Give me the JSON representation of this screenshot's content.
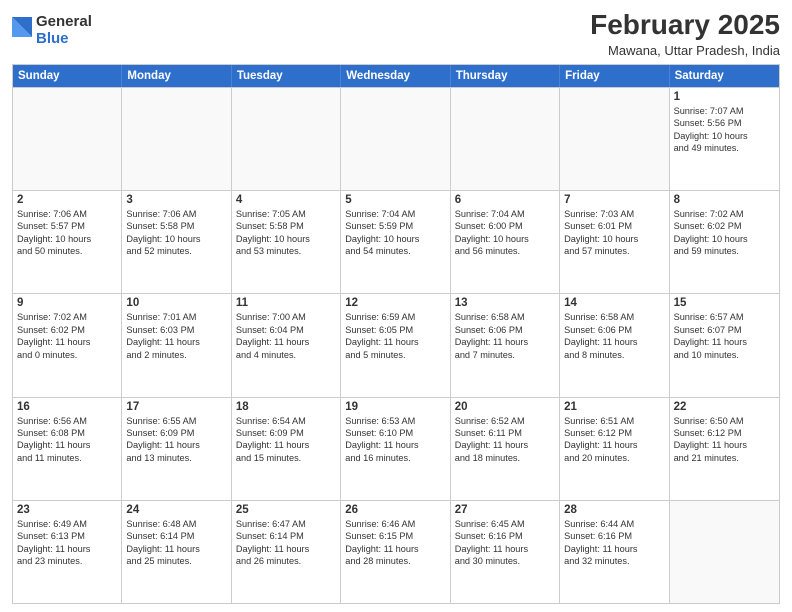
{
  "header": {
    "logo_general": "General",
    "logo_blue": "Blue",
    "month_title": "February 2025",
    "location": "Mawana, Uttar Pradesh, India"
  },
  "weekdays": [
    "Sunday",
    "Monday",
    "Tuesday",
    "Wednesday",
    "Thursday",
    "Friday",
    "Saturday"
  ],
  "rows": [
    [
      {
        "day": "",
        "info": ""
      },
      {
        "day": "",
        "info": ""
      },
      {
        "day": "",
        "info": ""
      },
      {
        "day": "",
        "info": ""
      },
      {
        "day": "",
        "info": ""
      },
      {
        "day": "",
        "info": ""
      },
      {
        "day": "1",
        "info": "Sunrise: 7:07 AM\nSunset: 5:56 PM\nDaylight: 10 hours\nand 49 minutes."
      }
    ],
    [
      {
        "day": "2",
        "info": "Sunrise: 7:06 AM\nSunset: 5:57 PM\nDaylight: 10 hours\nand 50 minutes."
      },
      {
        "day": "3",
        "info": "Sunrise: 7:06 AM\nSunset: 5:58 PM\nDaylight: 10 hours\nand 52 minutes."
      },
      {
        "day": "4",
        "info": "Sunrise: 7:05 AM\nSunset: 5:58 PM\nDaylight: 10 hours\nand 53 minutes."
      },
      {
        "day": "5",
        "info": "Sunrise: 7:04 AM\nSunset: 5:59 PM\nDaylight: 10 hours\nand 54 minutes."
      },
      {
        "day": "6",
        "info": "Sunrise: 7:04 AM\nSunset: 6:00 PM\nDaylight: 10 hours\nand 56 minutes."
      },
      {
        "day": "7",
        "info": "Sunrise: 7:03 AM\nSunset: 6:01 PM\nDaylight: 10 hours\nand 57 minutes."
      },
      {
        "day": "8",
        "info": "Sunrise: 7:02 AM\nSunset: 6:02 PM\nDaylight: 10 hours\nand 59 minutes."
      }
    ],
    [
      {
        "day": "9",
        "info": "Sunrise: 7:02 AM\nSunset: 6:02 PM\nDaylight: 11 hours\nand 0 minutes."
      },
      {
        "day": "10",
        "info": "Sunrise: 7:01 AM\nSunset: 6:03 PM\nDaylight: 11 hours\nand 2 minutes."
      },
      {
        "day": "11",
        "info": "Sunrise: 7:00 AM\nSunset: 6:04 PM\nDaylight: 11 hours\nand 4 minutes."
      },
      {
        "day": "12",
        "info": "Sunrise: 6:59 AM\nSunset: 6:05 PM\nDaylight: 11 hours\nand 5 minutes."
      },
      {
        "day": "13",
        "info": "Sunrise: 6:58 AM\nSunset: 6:06 PM\nDaylight: 11 hours\nand 7 minutes."
      },
      {
        "day": "14",
        "info": "Sunrise: 6:58 AM\nSunset: 6:06 PM\nDaylight: 11 hours\nand 8 minutes."
      },
      {
        "day": "15",
        "info": "Sunrise: 6:57 AM\nSunset: 6:07 PM\nDaylight: 11 hours\nand 10 minutes."
      }
    ],
    [
      {
        "day": "16",
        "info": "Sunrise: 6:56 AM\nSunset: 6:08 PM\nDaylight: 11 hours\nand 11 minutes."
      },
      {
        "day": "17",
        "info": "Sunrise: 6:55 AM\nSunset: 6:09 PM\nDaylight: 11 hours\nand 13 minutes."
      },
      {
        "day": "18",
        "info": "Sunrise: 6:54 AM\nSunset: 6:09 PM\nDaylight: 11 hours\nand 15 minutes."
      },
      {
        "day": "19",
        "info": "Sunrise: 6:53 AM\nSunset: 6:10 PM\nDaylight: 11 hours\nand 16 minutes."
      },
      {
        "day": "20",
        "info": "Sunrise: 6:52 AM\nSunset: 6:11 PM\nDaylight: 11 hours\nand 18 minutes."
      },
      {
        "day": "21",
        "info": "Sunrise: 6:51 AM\nSunset: 6:12 PM\nDaylight: 11 hours\nand 20 minutes."
      },
      {
        "day": "22",
        "info": "Sunrise: 6:50 AM\nSunset: 6:12 PM\nDaylight: 11 hours\nand 21 minutes."
      }
    ],
    [
      {
        "day": "23",
        "info": "Sunrise: 6:49 AM\nSunset: 6:13 PM\nDaylight: 11 hours\nand 23 minutes."
      },
      {
        "day": "24",
        "info": "Sunrise: 6:48 AM\nSunset: 6:14 PM\nDaylight: 11 hours\nand 25 minutes."
      },
      {
        "day": "25",
        "info": "Sunrise: 6:47 AM\nSunset: 6:14 PM\nDaylight: 11 hours\nand 26 minutes."
      },
      {
        "day": "26",
        "info": "Sunrise: 6:46 AM\nSunset: 6:15 PM\nDaylight: 11 hours\nand 28 minutes."
      },
      {
        "day": "27",
        "info": "Sunrise: 6:45 AM\nSunset: 6:16 PM\nDaylight: 11 hours\nand 30 minutes."
      },
      {
        "day": "28",
        "info": "Sunrise: 6:44 AM\nSunset: 6:16 PM\nDaylight: 11 hours\nand 32 minutes."
      },
      {
        "day": "",
        "info": ""
      }
    ]
  ]
}
